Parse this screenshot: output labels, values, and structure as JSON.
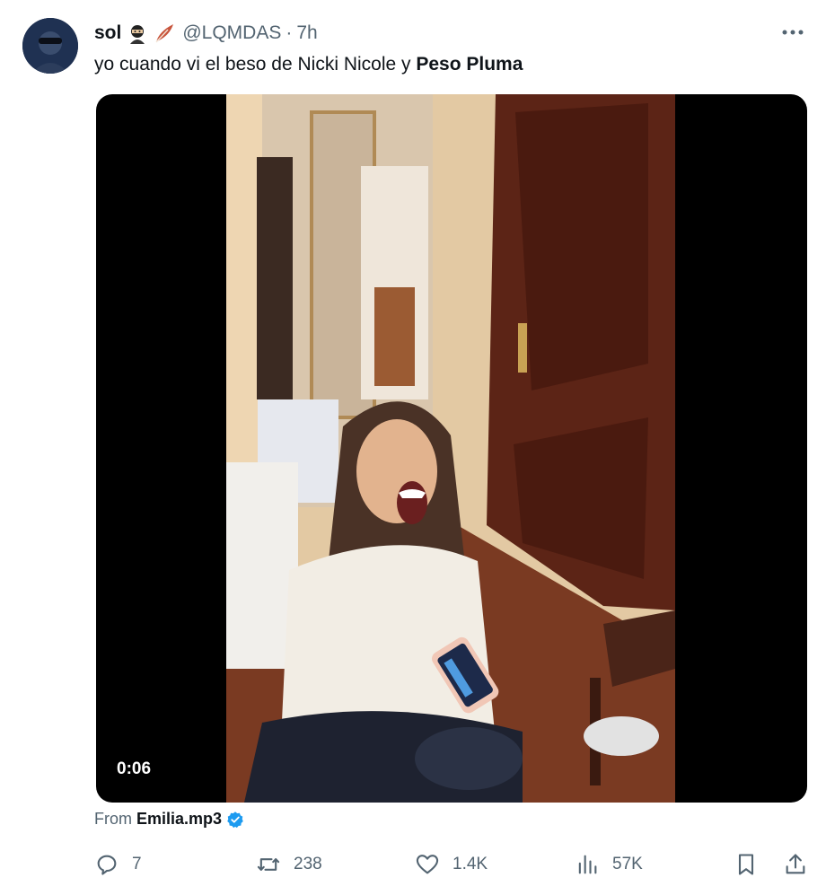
{
  "author": {
    "name": "sol",
    "handle": "@LQMDAS",
    "separator": "·",
    "time": "7h",
    "emojis": [
      "ninja-emoji",
      "feather-emoji"
    ]
  },
  "tweet": {
    "text_plain": "yo cuando vi el beso de Nicki Nicole y ",
    "text_bold": "Peso Pluma"
  },
  "media": {
    "duration": "0:06",
    "from_label": "From",
    "source_name": "Emilia.mp3"
  },
  "actions": {
    "replies": "7",
    "reposts": "238",
    "likes": "1.4K",
    "views": "57K"
  },
  "icons": {
    "more": "more-horizontal-icon",
    "reply": "reply-bubble-icon",
    "repost": "repost-arrows-icon",
    "like": "heart-icon",
    "views": "bar-chart-icon",
    "bookmark": "bookmark-icon",
    "share": "share-upload-icon",
    "verified": "verified-badge-icon"
  },
  "colors": {
    "text_primary": "#0f1419",
    "text_secondary": "#536471",
    "verified_blue": "#1d9bf0",
    "media_background": "#000000"
  }
}
